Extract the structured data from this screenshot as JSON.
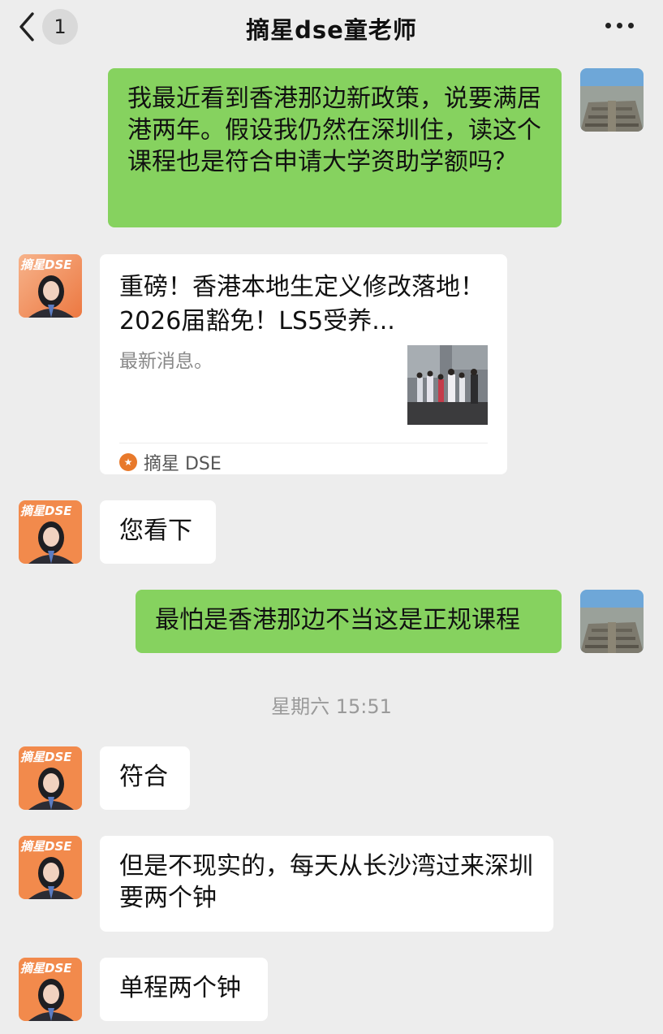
{
  "header": {
    "unread_count": "1",
    "title": "摘星dse童老师"
  },
  "messages": [
    {
      "from": "self",
      "text": "我最近看到香港那边新政策，说要满居港两年。假设我仍然在深圳住，读这个课程也是符合申请大学资助学额吗？"
    },
    {
      "from": "teacher",
      "type": "link_card",
      "card": {
        "title": "重磅！香港本地生定义修改落地！2026届豁免！LS5受养...",
        "description": "最新消息。",
        "source": "摘星 DSE"
      }
    },
    {
      "from": "teacher",
      "text": "您看下"
    },
    {
      "from": "self",
      "text": "最怕是香港那边不当这是正规课程"
    },
    {
      "from": "teacher",
      "text": "符合"
    },
    {
      "from": "teacher",
      "text": "但是不现实的，每天从长沙湾过来深圳要两个钟"
    },
    {
      "from": "teacher",
      "text": "单程两个钟"
    }
  ],
  "timestamp": "星期六 15:51",
  "avatars": {
    "teacher_badge": "摘星DSE"
  },
  "colors": {
    "background": "#ededed",
    "self_bubble": "#86d25f",
    "teacher_bubble": "#ffffff",
    "timestamp_text": "#9a9a9a"
  }
}
